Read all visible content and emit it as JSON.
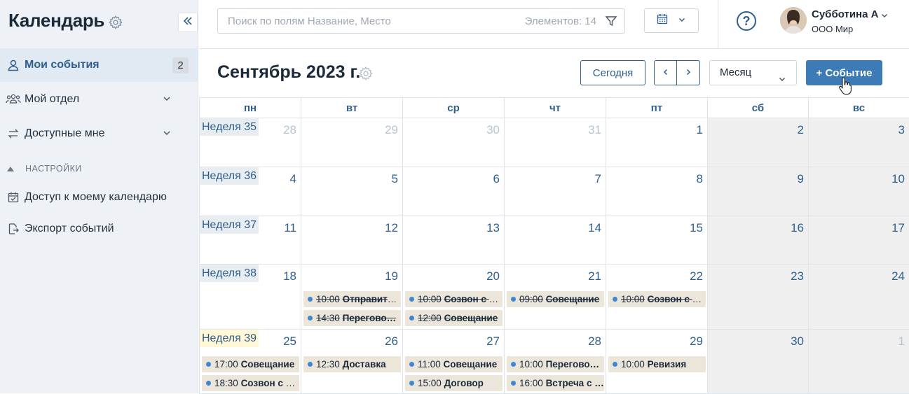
{
  "sidebar": {
    "title": "Календарь",
    "items": [
      {
        "label": "Мои события",
        "badge": "2"
      },
      {
        "label": "Мой отдел"
      },
      {
        "label": "Доступные мне"
      }
    ],
    "section_label": "НАСТРОЙКИ",
    "settings_items": [
      {
        "label": "Доступ к моему календарю"
      },
      {
        "label": "Экспорт событий"
      }
    ]
  },
  "topbar": {
    "search_placeholder": "Поиск по полям Название, Место",
    "items_count": "Элементов: 14",
    "help": "?",
    "user_name": "Субботина А",
    "user_org": "ООО Мир"
  },
  "header": {
    "month_title": "Сентябрь 2023 г.",
    "today_label": "Сегодня",
    "view_mode": "Месяц",
    "new_event_label": "+ Событие"
  },
  "calendar": {
    "days_of_week": [
      "пн",
      "вт",
      "ср",
      "чт",
      "пт",
      "сб",
      "вс"
    ],
    "weeks": [
      {
        "label": "Неделя 35",
        "days": [
          "28",
          "29",
          "30",
          "31",
          "1",
          "2",
          "3"
        ]
      },
      {
        "label": "Неделя 36",
        "days": [
          "4",
          "5",
          "6",
          "7",
          "8",
          "9",
          "10"
        ]
      },
      {
        "label": "Неделя 37",
        "days": [
          "11",
          "12",
          "13",
          "14",
          "15",
          "16",
          "17"
        ]
      },
      {
        "label": "Неделя 38",
        "days": [
          "18",
          "19",
          "20",
          "21",
          "22",
          "23",
          "24"
        ]
      },
      {
        "label": "Неделя 39",
        "days": [
          "25",
          "26",
          "27",
          "28",
          "29",
          "30",
          "1"
        ]
      }
    ],
    "events": {
      "w38_tue_1": {
        "time": "10:00",
        "name": "Отправить…"
      },
      "w38_tue_2": {
        "time": "14:30",
        "name": "Перегово…"
      },
      "w38_wed_1": {
        "time": "10:00",
        "name": "Созвон с к…"
      },
      "w38_wed_2": {
        "time": "12:00",
        "name": "Совещание"
      },
      "w38_thu_1": {
        "time": "09:00",
        "name": "Совещание"
      },
      "w38_fri_1": {
        "time": "10:00",
        "name": "Созвон с к…"
      },
      "w39_mon_1": {
        "time": "17:00",
        "name": "Совещание"
      },
      "w39_mon_2": {
        "time": "18:30",
        "name": "Созвон с к…"
      },
      "w39_tue_1": {
        "time": "12:30",
        "name": "Доставка"
      },
      "w39_wed_1": {
        "time": "11:00",
        "name": "Совещание"
      },
      "w39_wed_2": {
        "time": "15:00",
        "name": "Договор"
      },
      "w39_thu_1": {
        "time": "10:00",
        "name": "Перегово…"
      },
      "w39_thu_2": {
        "time": "16:00",
        "name": "Встреча с …"
      },
      "w39_fri_1": {
        "time": "10:00",
        "name": "Ревизия"
      }
    }
  },
  "colors": {
    "accent": "#2f5f8e",
    "primary_button": "#3d7bb6",
    "event_bg": "#ece5da",
    "event_dot": "#3d86d4",
    "weekend_bg": "#efefef"
  },
  "icons": [
    "gear-icon",
    "double-chevron-left-icon",
    "user-icon",
    "team-icon",
    "transfer-icon",
    "calendar-check-icon",
    "export-icon",
    "filter-icon",
    "calendar-icon",
    "help-icon",
    "cursor-hand-icon"
  ]
}
